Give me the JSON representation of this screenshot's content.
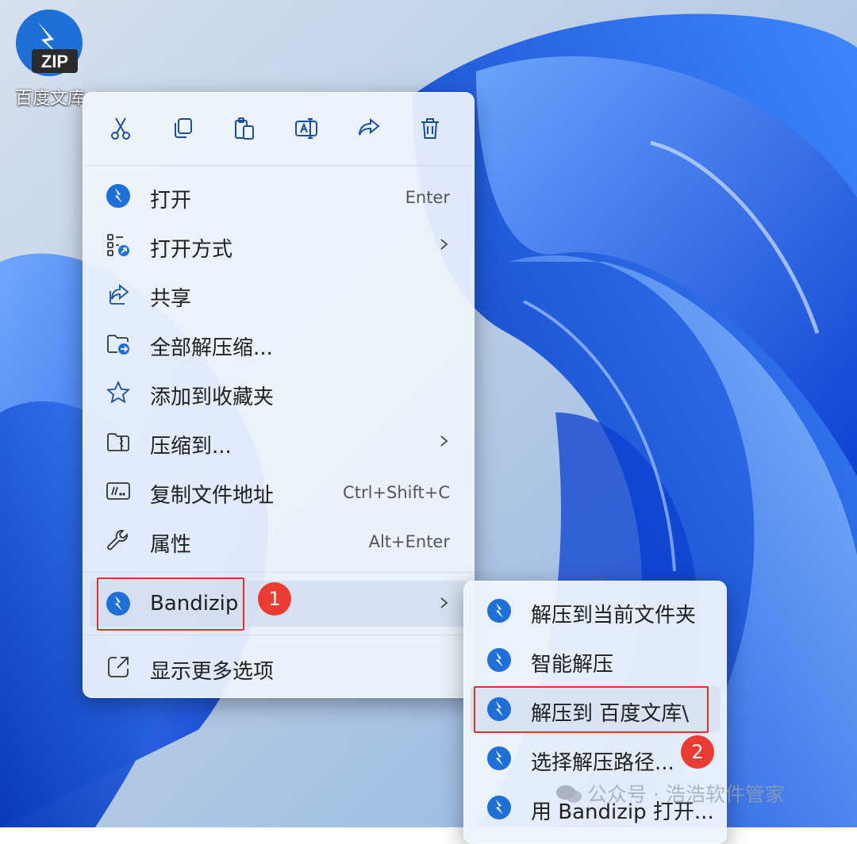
{
  "desktop": {
    "icon": {
      "name": "zip-archive-icon",
      "badge_text": "ZIP",
      "label": "百度文库"
    },
    "wallpaper": {
      "base": "#1a5ae6",
      "light": "#c9d7e8"
    }
  },
  "context_menu": {
    "toolbar": [
      "scissors-icon",
      "copy-icon",
      "paste-icon",
      "rename-icon",
      "share-icon",
      "trash-icon"
    ],
    "items": [
      {
        "label": "打开",
        "shortcut": "Enter",
        "icon": "bandizip-icon"
      },
      {
        "label": "打开方式",
        "icon": "open-with-icon",
        "has_submenu": true
      },
      {
        "label": "共享",
        "icon": "share-icon"
      },
      {
        "label": "全部解压缩...",
        "icon": "extract-folder-icon"
      },
      {
        "label": "添加到收藏夹",
        "icon": "star-icon"
      },
      {
        "label": "压缩到...",
        "icon": "zip-folder-icon",
        "has_submenu": true
      },
      {
        "label": "复制文件地址",
        "shortcut": "Ctrl+Shift+C",
        "icon": "path-icon"
      },
      {
        "label": "属性",
        "shortcut": "Alt+Enter",
        "icon": "wrench-icon"
      },
      {
        "label": "Bandizip",
        "icon": "bandizip-icon",
        "has_submenu": true,
        "highlighted": true,
        "step_badge": "1"
      },
      {
        "label": "显示更多选项",
        "icon": "more-options-icon"
      }
    ]
  },
  "submenu": {
    "items": [
      {
        "label": "解压到当前文件夹",
        "icon": "bandizip-icon"
      },
      {
        "label": "智能解压",
        "icon": "bandizip-icon"
      },
      {
        "label": "解压到 百度文库\\",
        "icon": "bandizip-icon",
        "highlighted": true
      },
      {
        "label": "选择解压路径...",
        "icon": "bandizip-icon",
        "step_badge": "2"
      },
      {
        "label": "用 Bandizip 打开...",
        "icon": "bandizip-icon"
      }
    ]
  },
  "watermark": {
    "text": "公众号 · 浩浩软件管家"
  },
  "colors": {
    "accent": "#1f6fd8",
    "annotation_red": "#e0312b",
    "badge_red": "#ec3b30"
  }
}
